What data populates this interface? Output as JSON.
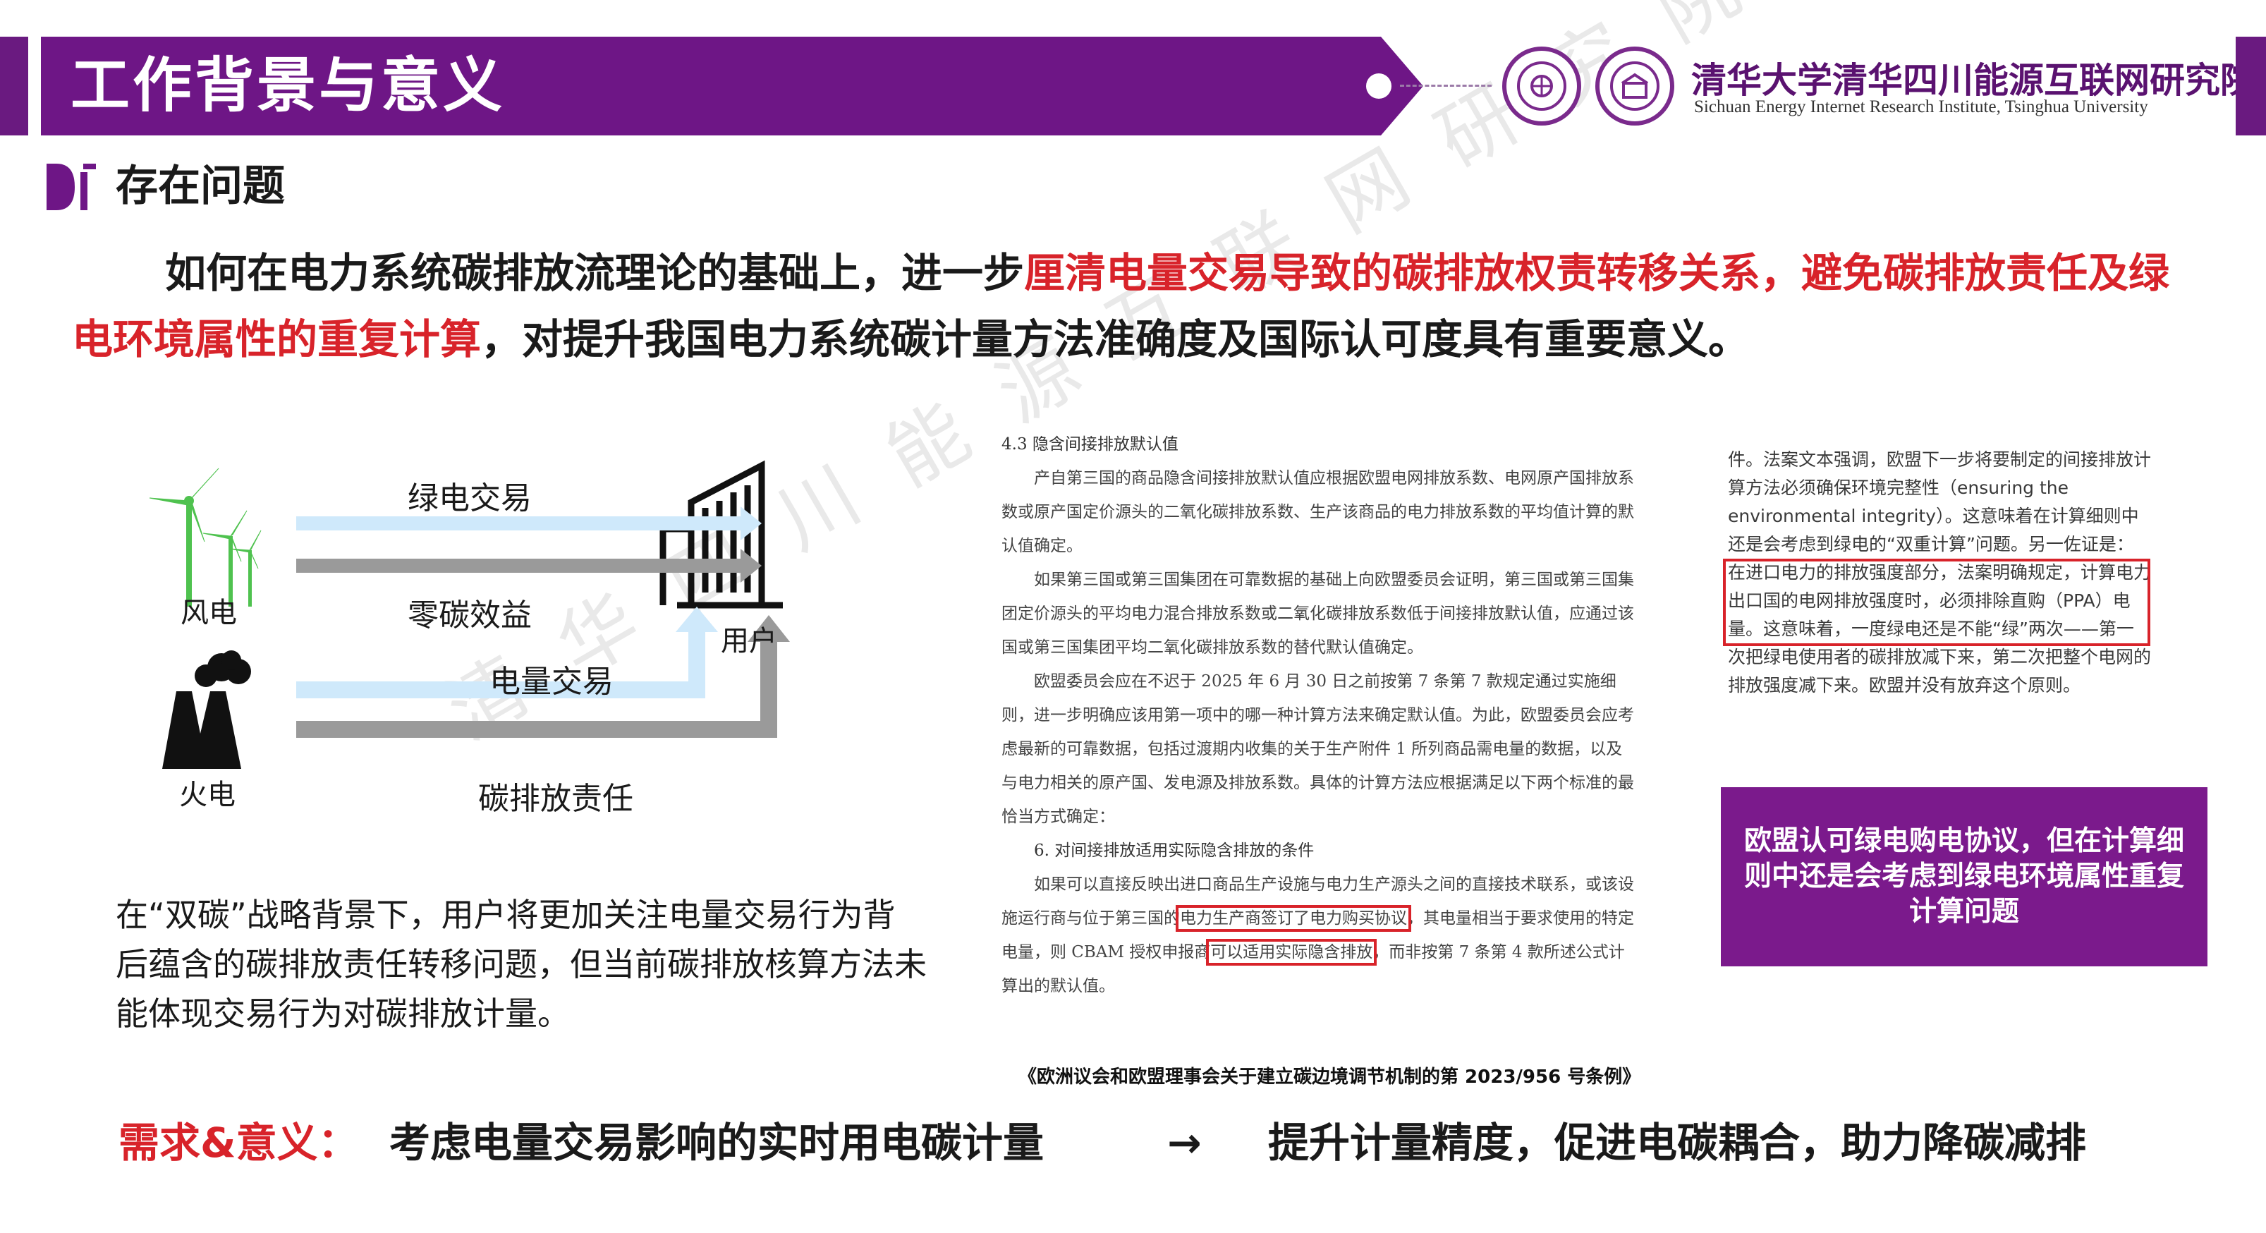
{
  "header": {
    "title": "工作背景与意义",
    "institute_cn": "清华大学清华四川能源互联网研究院",
    "institute_en": "Sichuan Energy Internet Research Institute, Tsinghua University"
  },
  "section": {
    "title": "存在问题"
  },
  "intro": {
    "part1": "如何在电力系统碳排放流理论的基础上，进一步",
    "highlight": "厘清电量交易导致的碳排放权责转移关系，避免碳排放责任及绿电环境属性的重复计算",
    "part2": "，对提升我国电力系统碳计量方法准确度及国际认可度具有重要意义。"
  },
  "diagram": {
    "wind_label": "风电",
    "thermal_label": "火电",
    "user_label": "用户",
    "arrow_green_trade": "绿电交易",
    "arrow_zero_carbon": "零碳效益",
    "arrow_power_trade": "电量交易",
    "arrow_carbon_resp": "碳排放责任"
  },
  "left_text": "在“双碳”战略背景下，用户将更加关注电量交易行为背后蕴含的碳排放责任转移问题，但当前碳排放核算方法未能体现交易行为对碳排放计量。",
  "doc": {
    "h1": "4.3 隐含间接排放默认值",
    "p1": "产自第三国的商品隐含间接排放默认值应根据欧盟电网排放系数、电网原产国排放系数或原产国定价源头的二氧化碳排放系数、生产该商品的电力排放系数的平均值计算的默认值确定。",
    "p2": "如果第三国或第三国集团在可靠数据的基础上向欧盟委员会证明，第三国或第三国集团定价源头的平均电力混合排放系数或二氧化碳排放系数低于间接排放默认值，应通过该国或第三国集团平均二氧化碳排放系数的替代默认值确定。",
    "p3": "欧盟委员会应在不迟于 2025 年 6 月 30 日之前按第 7 条第 7 款规定通过实施细则，进一步明确应该用第一项中的哪一种计算方法来确定默认值。为此，欧盟委员会应考虑最新的可靠数据，包括过渡期内收集的关于生产附件 1 所列商品需电量的数据，以及与电力相关的原产国、发电源及排放系数。具体的计算方法应根据满足以下两个标准的最恰当方式确定：",
    "h2": "6. 对间接排放适用实际隐含排放的条件",
    "p4a": "如果可以直接反映出进口商品生产设施与电力生产源头之间的直接技术联系，或该设施运行商与位于第三国的",
    "p4box1": "电力生产商签订了电力购买协议",
    "p4b": "，其电量相当于要求使用的特定电量，则 CBAM 授权申报商",
    "p4box2": "可以适用实际隐含排放",
    "p4c": "，而非按第 7 条第 4 款所述公式计算出的默认值。",
    "caption": "《欧洲议会和欧盟理事会关于建立碳边境调节机制的第 2023/956 号条例》"
  },
  "quote": {
    "text": "件。法案文本强调，欧盟下一步将要制定的间接排放计算方法必须确保环境完整性（ensuring the environmental integrity）。这意味着在计算细则中还是会考虑到绿电的“双重计算”问题。另一佐证是：在进口电力的排放强度部分，法案明确规定，计算电力出口国的电网排放强度时，必须排除直购（PPA）电量。这意味着，一度绿电还是不能“绿”两次——第一次把绿电使用者的碳排放减下来，第二次把整个电网的排放强度减下来。欧盟并没有放弃这个原则。"
  },
  "purple_box": {
    "text": "欧盟认可绿电购电协议，但在计算细则中还是会考虑到绿电环境属性重复计算问题"
  },
  "bottom": {
    "need_label": "需求&意义：",
    "item1": "考虑电量交易影响的实时用电碳计量",
    "arrow": "→",
    "item2": "提升计量精度，促进电碳耦合，助力降碳减排"
  },
  "watermark": "清华四川能源互联网研究院",
  "colors": {
    "brand_purple": "#6e1686",
    "highlight_red": "#d8232a",
    "arrow_blue": "#cfe9fb",
    "arrow_gray": "#9a9a9a"
  }
}
